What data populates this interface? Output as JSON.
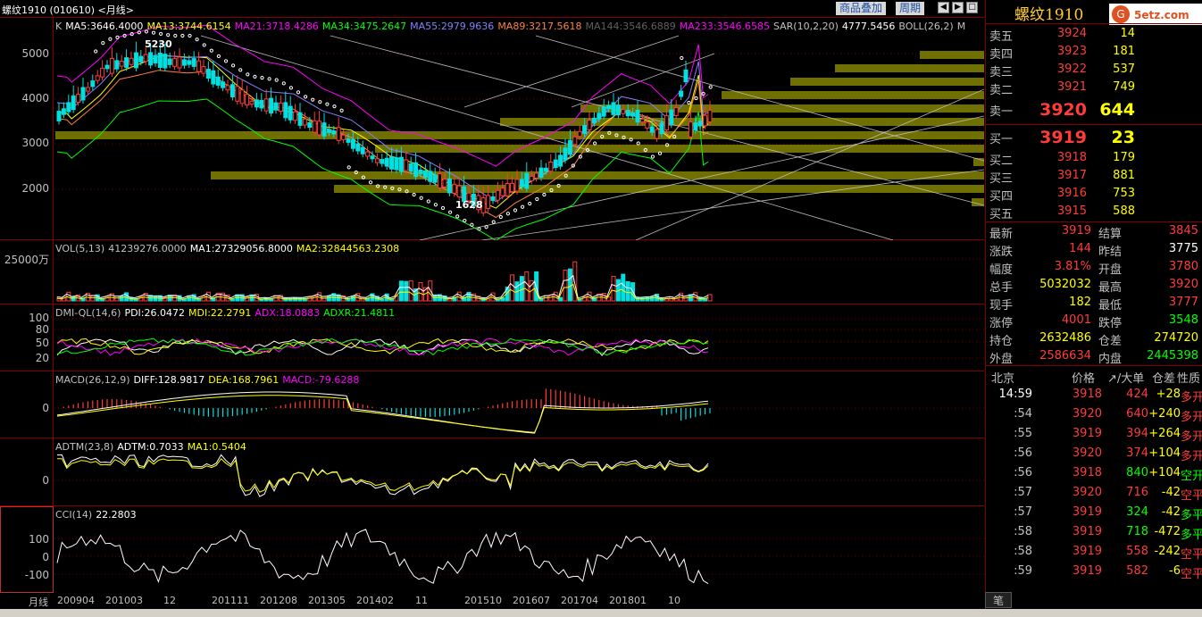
{
  "header": {
    "title": "螺纹1910 (010610) <月线>",
    "btn_overlay": "商品叠加",
    "btn_period": "周期"
  },
  "main_indicators": [
    {
      "text": "K",
      "color": "#c0c0c0"
    },
    {
      "text": "MA5:3646.4000",
      "color": "#ffffff"
    },
    {
      "text": "MA13:3744.6154",
      "color": "#ffff00"
    },
    {
      "text": "MA21:3718.4286",
      "color": "#ff00ff"
    },
    {
      "text": "MA34:3475.2647",
      "color": "#00ff00"
    },
    {
      "text": "MA55:2979.9636",
      "color": "#8080ff"
    },
    {
      "text": "MA89:3217.5618",
      "color": "#ff8040"
    },
    {
      "text": "MA144:3546.6889",
      "color": "#606060"
    },
    {
      "text": "MA233:3546.6585",
      "color": "#ff00ff"
    },
    {
      "text": "SAR(10,2,20)",
      "color": "#c0c0c0"
    },
    {
      "text": "4777.5456",
      "color": "#ffffff"
    },
    {
      "text": "BOLL(26,2)",
      "color": "#c0c0c0"
    },
    {
      "text": "M",
      "color": "#c0c0c0"
    }
  ],
  "main_axis": [
    "5000",
    "4000",
    "3000",
    "2000"
  ],
  "main_annotations": {
    "high": "5230",
    "low": "1628"
  },
  "vol": {
    "axis": [
      "25000万"
    ],
    "line": [
      {
        "text": "VOL(5,13)",
        "color": "#c0c0c0"
      },
      {
        "text": "41239276.0000",
        "color": "#c0c0c0"
      },
      {
        "text": "MA1:27329056.8000",
        "color": "#ffffff"
      },
      {
        "text": "MA2:32844563.2308",
        "color": "#ffff00"
      }
    ]
  },
  "dmi": {
    "axis": [
      "100",
      "80",
      "50",
      "20"
    ],
    "line": [
      {
        "text": "DMI-QL(14,6)",
        "color": "#c0c0c0"
      },
      {
        "text": "PDI:26.0472",
        "color": "#ffffff"
      },
      {
        "text": "MDI:22.2791",
        "color": "#ffff00"
      },
      {
        "text": "ADX:18.0883",
        "color": "#ff00ff"
      },
      {
        "text": "ADXR:21.4811",
        "color": "#00ff00"
      }
    ]
  },
  "macd": {
    "axis": [
      "0"
    ],
    "line": [
      {
        "text": "MACD(26,12,9)",
        "color": "#c0c0c0"
      },
      {
        "text": "DIFF:128.9817",
        "color": "#ffffff"
      },
      {
        "text": "DEA:168.7961",
        "color": "#ffff00"
      },
      {
        "text": "MACD:-79.6288",
        "color": "#ff00ff"
      }
    ]
  },
  "adtm": {
    "axis": [
      "0"
    ],
    "line": [
      {
        "text": "ADTM(23,8)",
        "color": "#c0c0c0"
      },
      {
        "text": "ADTM:0.7033",
        "color": "#ffffff"
      },
      {
        "text": "MA1:0.5404",
        "color": "#ffff00"
      }
    ]
  },
  "cci": {
    "axis": [
      "100",
      "0",
      "-100"
    ],
    "line": [
      {
        "text": "CCI(14)",
        "color": "#c0c0c0"
      },
      {
        "text": "22.2803",
        "color": "#ffffff"
      }
    ]
  },
  "xaxis": {
    "label": "月线",
    "ticks": [
      "200904",
      "201003",
      "12",
      "201111",
      "201208",
      "201305",
      "201402",
      "11",
      "201510",
      "201607",
      "201704",
      "201801",
      "10"
    ]
  },
  "quote": {
    "symbol": "螺纹1910",
    "logo_text": "5etz.com",
    "sells": [
      {
        "label": "卖五",
        "price": "3924",
        "vol": "14"
      },
      {
        "label": "卖四",
        "price": "3923",
        "vol": "181"
      },
      {
        "label": "卖三",
        "price": "3922",
        "vol": "537"
      },
      {
        "label": "卖二",
        "price": "3921",
        "vol": "749"
      },
      {
        "label": "卖一",
        "price": "3920",
        "vol": "644"
      }
    ],
    "buys": [
      {
        "label": "买一",
        "price": "3919",
        "vol": "23"
      },
      {
        "label": "买二",
        "price": "3918",
        "vol": "179"
      },
      {
        "label": "买三",
        "price": "3917",
        "vol": "881"
      },
      {
        "label": "买四",
        "price": "3916",
        "vol": "753"
      },
      {
        "label": "买五",
        "price": "3915",
        "vol": "588"
      }
    ],
    "stats": [
      {
        "k1": "最新",
        "v1": "3919",
        "c1": "#ff3b3b",
        "k2": "结算",
        "v2": "3845",
        "c2": "#ff3b3b"
      },
      {
        "k1": "涨跌",
        "v1": "144",
        "c1": "#ff3b3b",
        "k2": "昨结",
        "v2": "3775",
        "c2": "#ffffff"
      },
      {
        "k1": "幅度",
        "v1": "3.81%",
        "c1": "#ff3b3b",
        "k2": "开盘",
        "v2": "3780",
        "c2": "#ff3b3b"
      },
      {
        "k1": "总手",
        "v1": "5032032",
        "c1": "#ffff00",
        "k2": "最高",
        "v2": "3920",
        "c2": "#ff3b3b"
      },
      {
        "k1": "现手",
        "v1": "182",
        "c1": "#ffff00",
        "k2": "最低",
        "v2": "3777",
        "c2": "#ff3b3b"
      },
      {
        "k1": "涨停",
        "v1": "4001",
        "c1": "#ff3b3b",
        "k2": "跌停",
        "v2": "3548",
        "c2": "#00ff00"
      },
      {
        "k1": "持仓",
        "v1": "2632486",
        "c1": "#ffff00",
        "k2": "仓差",
        "v2": "274720",
        "c2": "#ffff00"
      },
      {
        "k1": "外盘",
        "v1": "2586634",
        "c1": "#ff3b3b",
        "k2": "内盘",
        "v2": "2445398",
        "c2": "#00ff00"
      }
    ],
    "tick_header": {
      "loc": "北京",
      "price": "价格",
      "big": "↗/大单",
      "oi": "仓差",
      "type": "性质"
    },
    "ticks": [
      {
        "t": "14:59",
        "p": "3918",
        "v": "424",
        "vc": "#ff3b3b",
        "oi": "+28",
        "ty": "多开",
        "tc": "#ff3b3b"
      },
      {
        "t": ":54",
        "p": "3920",
        "v": "640",
        "vc": "#ff3b3b",
        "oi": "+240",
        "ty": "多开",
        "tc": "#ff3b3b"
      },
      {
        "t": ":55",
        "p": "3919",
        "v": "394",
        "vc": "#ff3b3b",
        "oi": "+264",
        "ty": "多开",
        "tc": "#ff3b3b"
      },
      {
        "t": ":56",
        "p": "3920",
        "v": "374",
        "vc": "#ff3b3b",
        "oi": "+104",
        "ty": "多开",
        "tc": "#ff3b3b"
      },
      {
        "t": ":56",
        "p": "3918",
        "v": "840",
        "vc": "#00ff00",
        "oi": "+104",
        "ty": "空开",
        "tc": "#00ff00"
      },
      {
        "t": ":57",
        "p": "3920",
        "v": "716",
        "vc": "#ff3b3b",
        "oi": "-42",
        "ty": "空平",
        "tc": "#ff3b3b"
      },
      {
        "t": ":57",
        "p": "3919",
        "v": "324",
        "vc": "#00ff00",
        "oi": "-42",
        "ty": "多平",
        "tc": "#00ff00"
      },
      {
        "t": ":58",
        "p": "3919",
        "v": "718",
        "vc": "#00ff00",
        "oi": "-472",
        "ty": "多平",
        "tc": "#00ff00"
      },
      {
        "t": ":58",
        "p": "3919",
        "v": "558",
        "vc": "#ff3b3b",
        "oi": "-242",
        "ty": "空平",
        "tc": "#ff3b3b"
      },
      {
        "t": ":59",
        "p": "3919",
        "v": "582",
        "vc": "#ff3b3b",
        "oi": "-6",
        "ty": "空平",
        "tc": "#ff3b3b"
      }
    ],
    "pen_tab": "笔"
  }
}
